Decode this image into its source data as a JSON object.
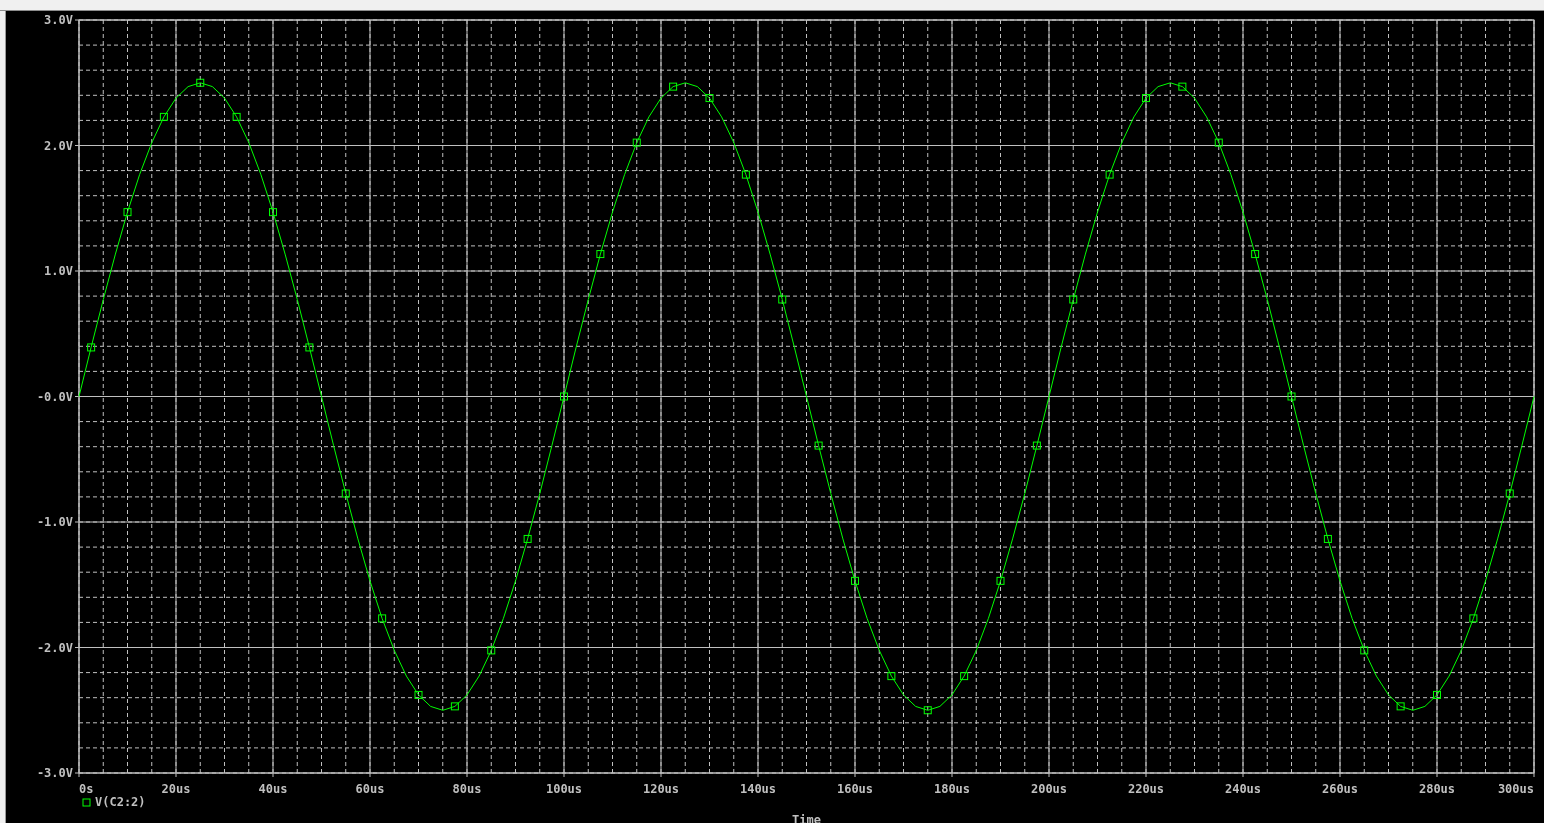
{
  "chart_data": {
    "type": "line",
    "grid": true,
    "xlabel": "Time",
    "x": [
      0,
      2.5,
      5,
      7.5,
      10,
      12.5,
      15,
      17.5,
      20,
      22.5,
      25,
      27.5,
      30,
      32.5,
      35,
      37.5,
      40,
      42.5,
      45,
      47.5,
      50,
      52.5,
      55,
      57.5,
      60,
      62.5,
      65,
      67.5,
      70,
      72.5,
      75,
      77.5,
      80,
      82.5,
      85,
      87.5,
      90,
      92.5,
      95,
      97.5,
      100,
      102.5,
      105,
      107.5,
      110,
      112.5,
      115,
      117.5,
      120,
      122.5,
      125,
      127.5,
      130,
      132.5,
      135,
      137.5,
      140,
      142.5,
      145,
      147.5,
      150,
      152.5,
      155,
      157.5,
      160,
      162.5,
      165,
      167.5,
      170,
      172.5,
      175,
      177.5,
      180,
      182.5,
      185,
      187.5,
      190,
      192.5,
      195,
      197.5,
      200,
      202.5,
      205,
      207.5,
      210,
      212.5,
      215,
      217.5,
      220,
      222.5,
      225,
      227.5,
      230,
      232.5,
      235,
      237.5,
      240,
      242.5,
      245,
      247.5,
      250,
      252.5,
      255,
      257.5,
      260,
      262.5,
      265,
      267.5,
      270,
      272.5,
      275,
      277.5,
      280,
      282.5,
      285,
      287.5,
      290,
      292.5,
      295,
      297.5,
      300
    ],
    "series": [
      {
        "name": "V(C2:2)",
        "color": "#00ff00",
        "values": [
          0,
          0.391,
          0.773,
          1.135,
          1.469,
          1.768,
          2.023,
          2.228,
          2.378,
          2.469,
          2.5,
          2.469,
          2.378,
          2.228,
          2.023,
          1.768,
          1.469,
          1.135,
          0.773,
          0.391,
          0,
          -0.391,
          -0.773,
          -1.135,
          -1.469,
          -1.768,
          -2.023,
          -2.228,
          -2.378,
          -2.469,
          -2.5,
          -2.469,
          -2.378,
          -2.228,
          -2.023,
          -1.768,
          -1.469,
          -1.135,
          -0.773,
          -0.391,
          0,
          0.391,
          0.773,
          1.135,
          1.469,
          1.768,
          2.023,
          2.228,
          2.378,
          2.469,
          2.5,
          2.469,
          2.378,
          2.228,
          2.023,
          1.768,
          1.469,
          1.135,
          0.773,
          0.391,
          0,
          -0.391,
          -0.773,
          -1.135,
          -1.469,
          -1.768,
          -2.023,
          -2.228,
          -2.378,
          -2.469,
          -2.5,
          -2.469,
          -2.378,
          -2.228,
          -2.023,
          -1.768,
          -1.469,
          -1.135,
          -0.773,
          -0.391,
          0,
          0.391,
          0.773,
          1.135,
          1.469,
          1.768,
          2.023,
          2.228,
          2.378,
          2.469,
          2.5,
          2.469,
          2.378,
          2.228,
          2.023,
          1.768,
          1.469,
          1.135,
          0.773,
          0.391,
          0,
          -0.391,
          -0.773,
          -1.135,
          -1.469,
          -1.768,
          -2.023,
          -2.228,
          -2.378,
          -2.469,
          -2.5,
          -2.469,
          -2.378,
          -2.228,
          -2.023,
          -1.768,
          -1.469,
          -1.135,
          -0.773,
          -0.391,
          0
        ]
      }
    ],
    "xlim": [
      0,
      300
    ],
    "ylim": [
      -3,
      3
    ],
    "xticks": [
      {
        "value": 0,
        "label": "0s"
      },
      {
        "value": 20,
        "label": "20us"
      },
      {
        "value": 40,
        "label": "40us"
      },
      {
        "value": 60,
        "label": "60us"
      },
      {
        "value": 80,
        "label": "80us"
      },
      {
        "value": 100,
        "label": "100us"
      },
      {
        "value": 120,
        "label": "120us"
      },
      {
        "value": 140,
        "label": "140us"
      },
      {
        "value": 160,
        "label": "160us"
      },
      {
        "value": 180,
        "label": "180us"
      },
      {
        "value": 200,
        "label": "200us"
      },
      {
        "value": 220,
        "label": "220us"
      },
      {
        "value": 240,
        "label": "240us"
      },
      {
        "value": 260,
        "label": "260us"
      },
      {
        "value": 280,
        "label": "280us"
      },
      {
        "value": 300,
        "label": "300us"
      }
    ],
    "yticks": [
      {
        "value": 3,
        "label": "3.0V"
      },
      {
        "value": 2,
        "label": "2.0V"
      },
      {
        "value": 1,
        "label": "1.0V"
      },
      {
        "value": 0,
        "label": "-0.0V"
      },
      {
        "value": -1,
        "label": "-1.0V"
      },
      {
        "value": -2,
        "label": "-2.0V"
      },
      {
        "value": -3,
        "label": "-3.0V"
      }
    ]
  }
}
